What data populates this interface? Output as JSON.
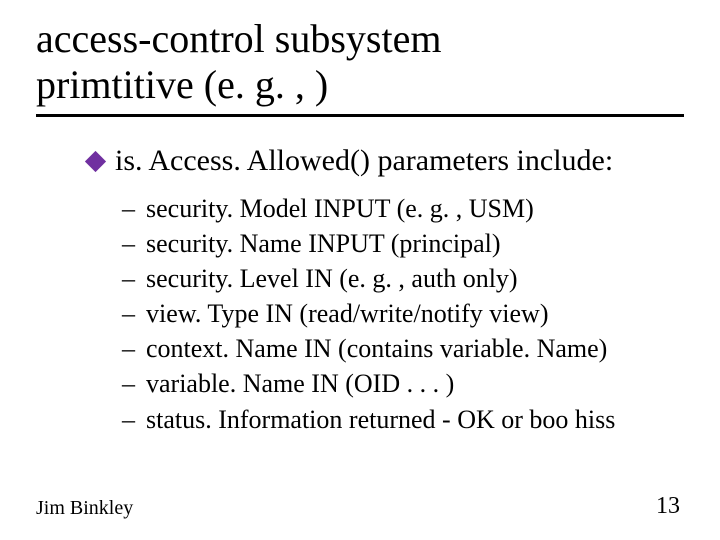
{
  "title_line1": "access-control subsystem",
  "title_line2": "primtitive (e. g. , )",
  "main_bullet": "is. Access. Allowed() parameters include:",
  "subs": [
    "security. Model  INPUT (e. g. , USM)",
    "security. Name INPUT (principal)",
    "security. Level IN (e. g. , auth only)",
    "view. Type IN (read/write/notify view)",
    "context. Name IN (contains variable. Name)",
    "variable. Name IN (OID . . . )",
    "status. Information returned - OK or boo hiss"
  ],
  "footer": "Jim Binkley",
  "page_number": "13"
}
